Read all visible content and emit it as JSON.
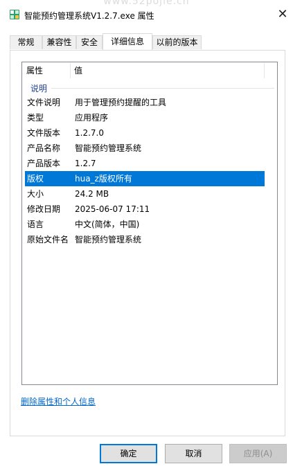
{
  "watermark": "www.52pojie.cn",
  "window": {
    "title": "智能预约管理系统V1.2.7.exe 属性",
    "close_glyph": "✕"
  },
  "tabs": [
    {
      "label": "常规",
      "active": false
    },
    {
      "label": "兼容性",
      "active": false
    },
    {
      "label": "安全",
      "active": false
    },
    {
      "label": "详细信息",
      "active": true
    },
    {
      "label": "以前的版本",
      "active": false
    }
  ],
  "details": {
    "columns": {
      "property": "属性",
      "value": "值"
    },
    "group": "说明",
    "rows": [
      {
        "key": "文件说明",
        "value": "用于管理预约提醒的工具",
        "selected": false
      },
      {
        "key": "类型",
        "value": "应用程序",
        "selected": false
      },
      {
        "key": "文件版本",
        "value": "1.2.7.0",
        "selected": false
      },
      {
        "key": "产品名称",
        "value": "智能预约管理系统",
        "selected": false
      },
      {
        "key": "产品版本",
        "value": "1.2.7",
        "selected": false
      },
      {
        "key": "版权",
        "value": "hua_z版权所有",
        "selected": true
      },
      {
        "key": "大小",
        "value": "24.2 MB",
        "selected": false
      },
      {
        "key": "修改日期",
        "value": "2025-06-07  17:11",
        "selected": false
      },
      {
        "key": "语言",
        "value": "中文(简体，中国)",
        "selected": false
      },
      {
        "key": "原始文件名",
        "value": "智能预约管理系统",
        "selected": false
      }
    ]
  },
  "remove_link": "删除属性和个人信息",
  "buttons": {
    "ok": "确定",
    "cancel": "取消",
    "apply": "应用(A)"
  },
  "colors": {
    "selection": "#0078d7",
    "link": "#0066cc",
    "group": "#1e3f8f"
  }
}
